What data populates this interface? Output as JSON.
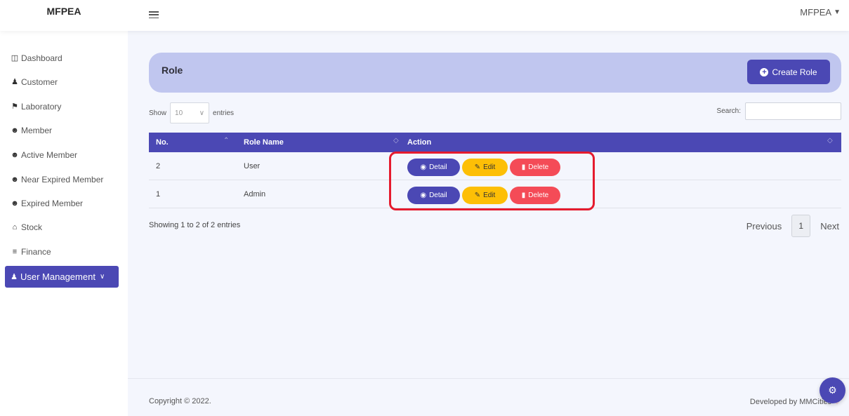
{
  "app": {
    "brand": "MFPEA",
    "user_menu_label": "MFPEA"
  },
  "sidebar": {
    "items": [
      {
        "label": "Dashboard",
        "icon": "dashboard-icon"
      },
      {
        "label": "Customer",
        "icon": "user-icon"
      },
      {
        "label": "Laboratory",
        "icon": "flask-icon"
      },
      {
        "label": "Member",
        "icon": "users-icon"
      },
      {
        "label": "Active Member",
        "icon": "users-icon"
      },
      {
        "label": "Near Expired Member",
        "icon": "users-icon"
      },
      {
        "label": "Expired Member",
        "icon": "users-icon"
      },
      {
        "label": "Stock",
        "icon": "warehouse-icon"
      },
      {
        "label": "Finance",
        "icon": "money-icon"
      },
      {
        "label": "User Management",
        "icon": "user-cog-icon",
        "active": true
      }
    ]
  },
  "page": {
    "title": "Role",
    "create_label": "Create Role"
  },
  "table_controls": {
    "show_label": "Show",
    "entries_value": "10",
    "entries_label": "entries",
    "search_label": "Search:"
  },
  "table": {
    "columns": [
      "No.",
      "Role Name",
      "Action"
    ],
    "rows": [
      {
        "no": "2",
        "role": "User"
      },
      {
        "no": "1",
        "role": "Admin"
      }
    ],
    "actions": {
      "detail": "Detail",
      "edit": "Edit",
      "delete": "Delete"
    }
  },
  "pagination": {
    "info": "Showing 1 to 2 of 2 entries",
    "previous": "Previous",
    "current_page": "1",
    "next": "Next"
  },
  "footer": {
    "copyright": "Copyright © 2022.",
    "developed_by": "Developed by MMCities"
  },
  "colors": {
    "primary": "#4b48b4",
    "header_bg": "#c0c6ef",
    "edit": "#fdbf06",
    "delete": "#f44b57",
    "highlight": "#e51b2e"
  }
}
